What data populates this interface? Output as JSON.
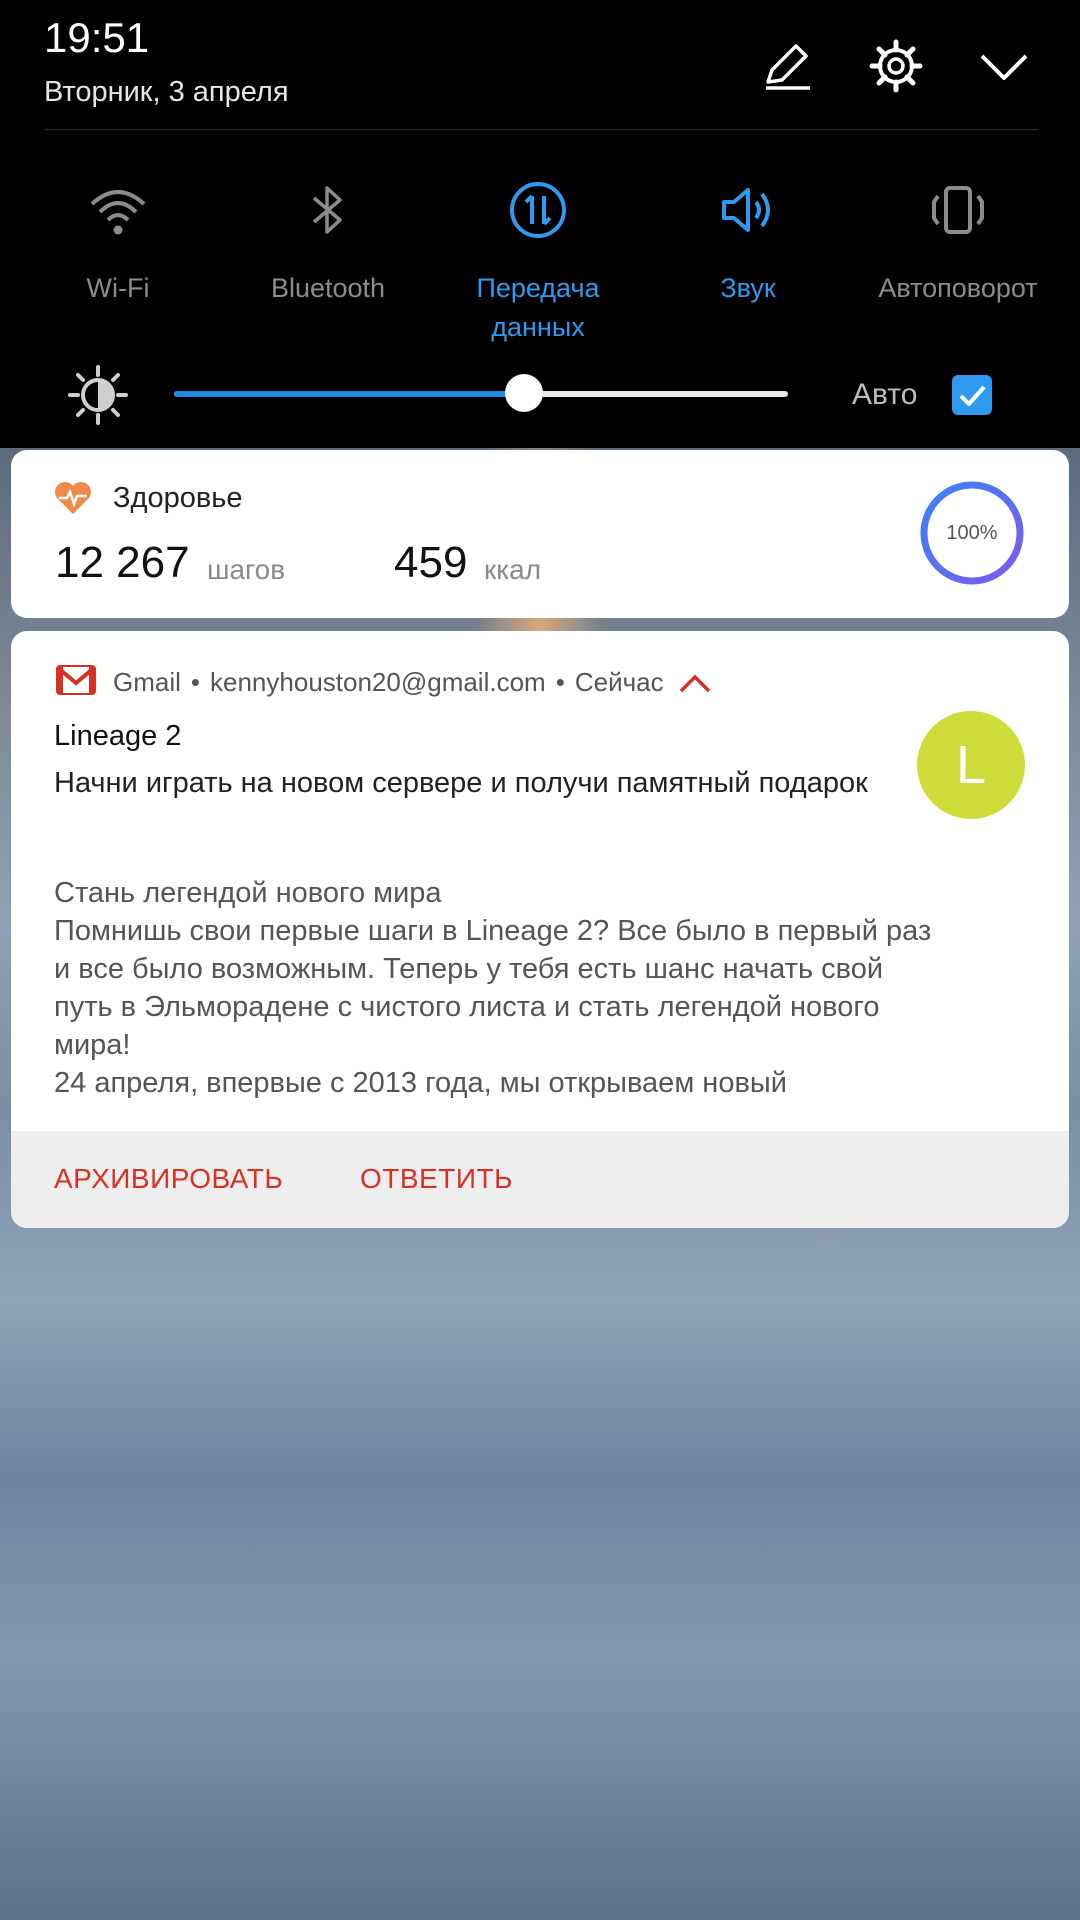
{
  "status": {
    "time": "19:51",
    "date": "Вторник, 3 апреля"
  },
  "header_icons": [
    "edit-icon",
    "settings-gear-icon",
    "collapse-chevron-icon"
  ],
  "quick_tiles": [
    {
      "label": "Wi-Fi",
      "icon": "wifi-icon",
      "active": false
    },
    {
      "label": "Bluetooth",
      "icon": "bluetooth-icon",
      "active": false
    },
    {
      "label": "Передача\nданных",
      "icon": "mobile-data-icon",
      "active": true
    },
    {
      "label": "Звук",
      "icon": "sound-icon",
      "active": true
    },
    {
      "label": "Автоповорот",
      "icon": "auto-rotate-icon",
      "active": false
    }
  ],
  "brightness": {
    "level": 0.57,
    "auto_label": "Авто",
    "auto_checked": true
  },
  "health_card": {
    "title": "Здоровье",
    "steps_value": "12 267",
    "steps_unit": "шагов",
    "kcal_value": "459",
    "kcal_unit": "ккал",
    "progress_text": "100%",
    "progress": 1.0
  },
  "gmail_notification": {
    "app": "Gmail",
    "account": "kennyhouston20@gmail.com",
    "time": "Сейчас",
    "avatar_letter": "L",
    "subject": "Lineage 2",
    "preview": "Начни играть на новом сервере и получи памятный подарок",
    "body_lines": [
      "Стань легендой нового мира",
      "Помнишь свои первые шаги в Lineage 2? Все было в первый раз",
      "и все было возможным. Теперь у тебя есть шанс начать свой",
      "путь в Эльморадене с чистого листа и стать легендой нового",
      "мира!",
      "24 апреля, впервые с 2013 года, мы открываем новый"
    ],
    "actions": {
      "archive": "АРХИВИРОВАТЬ",
      "reply": "ОТВЕТИТЬ"
    }
  },
  "colors": {
    "accent_blue": "#2e9bf0",
    "gmail_red": "#d93025",
    "avatar_lime": "#cddc39",
    "health_orange": "#f08a4b"
  }
}
